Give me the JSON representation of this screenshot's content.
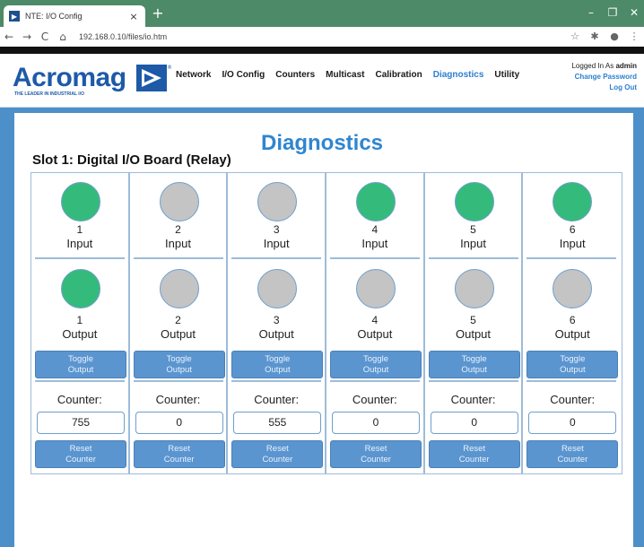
{
  "browser": {
    "tab_title": "NTE: I/O Config",
    "tab_close": "×",
    "new_tab": "+",
    "url": "192.168.0.10/files/io.htm",
    "minimize": "–",
    "maximize": "❐",
    "close": "✕"
  },
  "header": {
    "logo_text": "Acromag",
    "logo_tagline": "THE LEADER IN INDUSTRIAL I/O",
    "logo_reg": "®",
    "nav": [
      "Network",
      "I/O Config",
      "Counters",
      "Multicast",
      "Calibration",
      "Diagnostics",
      "Utility"
    ],
    "active_nav": "Diagnostics",
    "logged_in_prefix": "Logged In As",
    "user": "admin",
    "change_password": "Change Password",
    "log_out": "Log Out"
  },
  "page": {
    "title": "Diagnostics",
    "slot_title": "Slot 1: Digital I/O Board (Relay)",
    "input_label": "Input",
    "output_label": "Output",
    "toggle_label_1": "Toggle",
    "toggle_label_2": "Output",
    "counter_label": "Counter:",
    "reset_label_1": "Reset",
    "reset_label_2": "Counter"
  },
  "channels": [
    {
      "num": "1",
      "input_on": true,
      "output_on": true,
      "counter": "755"
    },
    {
      "num": "2",
      "input_on": false,
      "output_on": false,
      "counter": "0"
    },
    {
      "num": "3",
      "input_on": false,
      "output_on": false,
      "counter": "555"
    },
    {
      "num": "4",
      "input_on": true,
      "output_on": false,
      "counter": "0"
    },
    {
      "num": "5",
      "input_on": true,
      "output_on": false,
      "counter": "0"
    },
    {
      "num": "6",
      "input_on": true,
      "output_on": false,
      "counter": "0"
    }
  ],
  "colors": {
    "led_on": "#34bb7b",
    "led_off": "#c4c4c4",
    "accent": "#2f86d0",
    "button": "#5b95d0"
  }
}
